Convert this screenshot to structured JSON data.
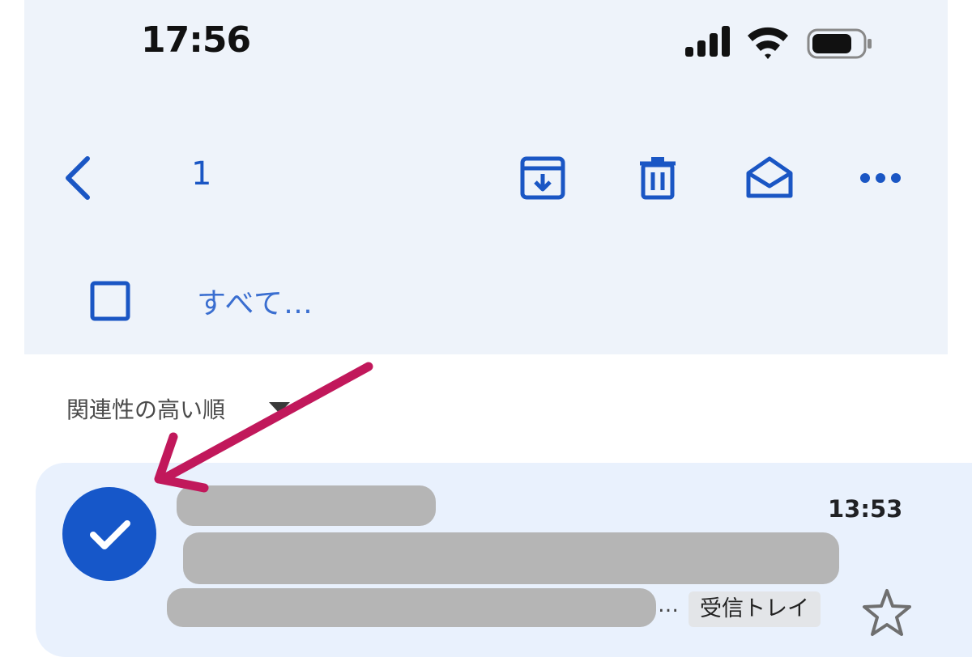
{
  "status_bar": {
    "time": "17:56",
    "icons": [
      "cellular-signal-icon",
      "wifi-icon",
      "battery-icon"
    ]
  },
  "toolbar": {
    "selected_count": "1",
    "icons": [
      "back-arrow-icon",
      "archive-icon",
      "trash-icon",
      "mark-read-icon",
      "more-icon"
    ]
  },
  "select_all": {
    "label": "すべて…"
  },
  "sort": {
    "label": "関連性の高い順"
  },
  "mail_item": {
    "time": "13:53",
    "snippet_ellipsis": "…",
    "label": "受信トレイ"
  },
  "colors": {
    "accent": "#1a56c4",
    "header_bg": "#eef3fa",
    "selected_row_bg": "#e9f1fd",
    "annotation_arrow": "#c1185b"
  }
}
